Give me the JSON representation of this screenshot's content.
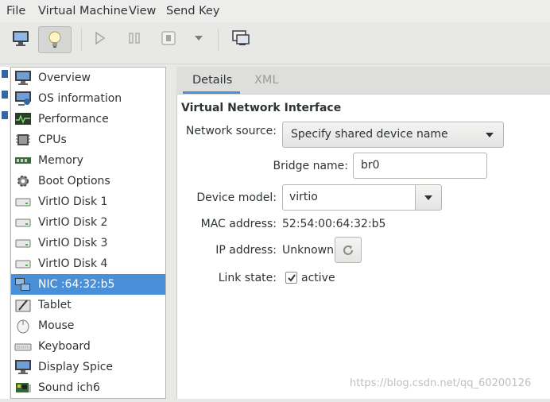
{
  "menubar": {
    "items": [
      "File",
      "Virtual Machine",
      "View",
      "Send Key"
    ]
  },
  "toolbar": {
    "buttons": [
      {
        "name": "console-view",
        "icon": "monitor-icon"
      },
      {
        "name": "details-view",
        "icon": "lightbulb-icon",
        "active": true
      },
      {
        "name": "run",
        "icon": "play-icon"
      },
      {
        "name": "pause",
        "icon": "pause-icon"
      },
      {
        "name": "shutdown",
        "icon": "stop-icon"
      },
      {
        "name": "shutdown-menu",
        "icon": "chevron-down-icon"
      },
      {
        "name": "fullscreen",
        "icon": "screens-icon"
      }
    ]
  },
  "sidebar": {
    "items": [
      {
        "label": "Overview",
        "icon": "monitor-icon"
      },
      {
        "label": "OS information",
        "icon": "monitor-info-icon"
      },
      {
        "label": "Performance",
        "icon": "performance-graph-icon"
      },
      {
        "label": "CPUs",
        "icon": "cpu-chip-icon"
      },
      {
        "label": "Memory",
        "icon": "memory-module-icon"
      },
      {
        "label": "Boot Options",
        "icon": "gear-icon"
      },
      {
        "label": "VirtIO Disk 1",
        "icon": "disk-icon"
      },
      {
        "label": "VirtIO Disk 2",
        "icon": "disk-icon"
      },
      {
        "label": "VirtIO Disk 3",
        "icon": "disk-icon"
      },
      {
        "label": "VirtIO Disk 4",
        "icon": "disk-icon"
      },
      {
        "label": "NIC :64:32:b5",
        "icon": "network-icon",
        "selected": true
      },
      {
        "label": "Tablet",
        "icon": "tablet-icon"
      },
      {
        "label": "Mouse",
        "icon": "mouse-icon"
      },
      {
        "label": "Keyboard",
        "icon": "keyboard-icon"
      },
      {
        "label": "Display Spice",
        "icon": "display-icon"
      },
      {
        "label": "Sound ich6",
        "icon": "sound-card-icon"
      }
    ]
  },
  "tabs": [
    {
      "label": "Details",
      "active": true
    },
    {
      "label": "XML",
      "active": false
    }
  ],
  "nic": {
    "section_title": "Virtual Network Interface",
    "network_source_label": "Network source:",
    "network_source_value": "Specify shared device name",
    "bridge_name_label": "Bridge name:",
    "bridge_name_value": "br0",
    "device_model_label": "Device model:",
    "device_model_value": "virtio",
    "mac_label": "MAC address:",
    "mac_value": "52:54:00:64:32:b5",
    "ip_label": "IP address:",
    "ip_value": "Unknown",
    "link_state_label": "Link state:",
    "link_state_value": "active",
    "link_state_checked": true
  },
  "watermark": "https://blog.csdn.net/qq_60200126",
  "colors": {
    "selection": "#4a90d9",
    "text": "#2e3436",
    "inactive_tab": "#9a9c98"
  }
}
